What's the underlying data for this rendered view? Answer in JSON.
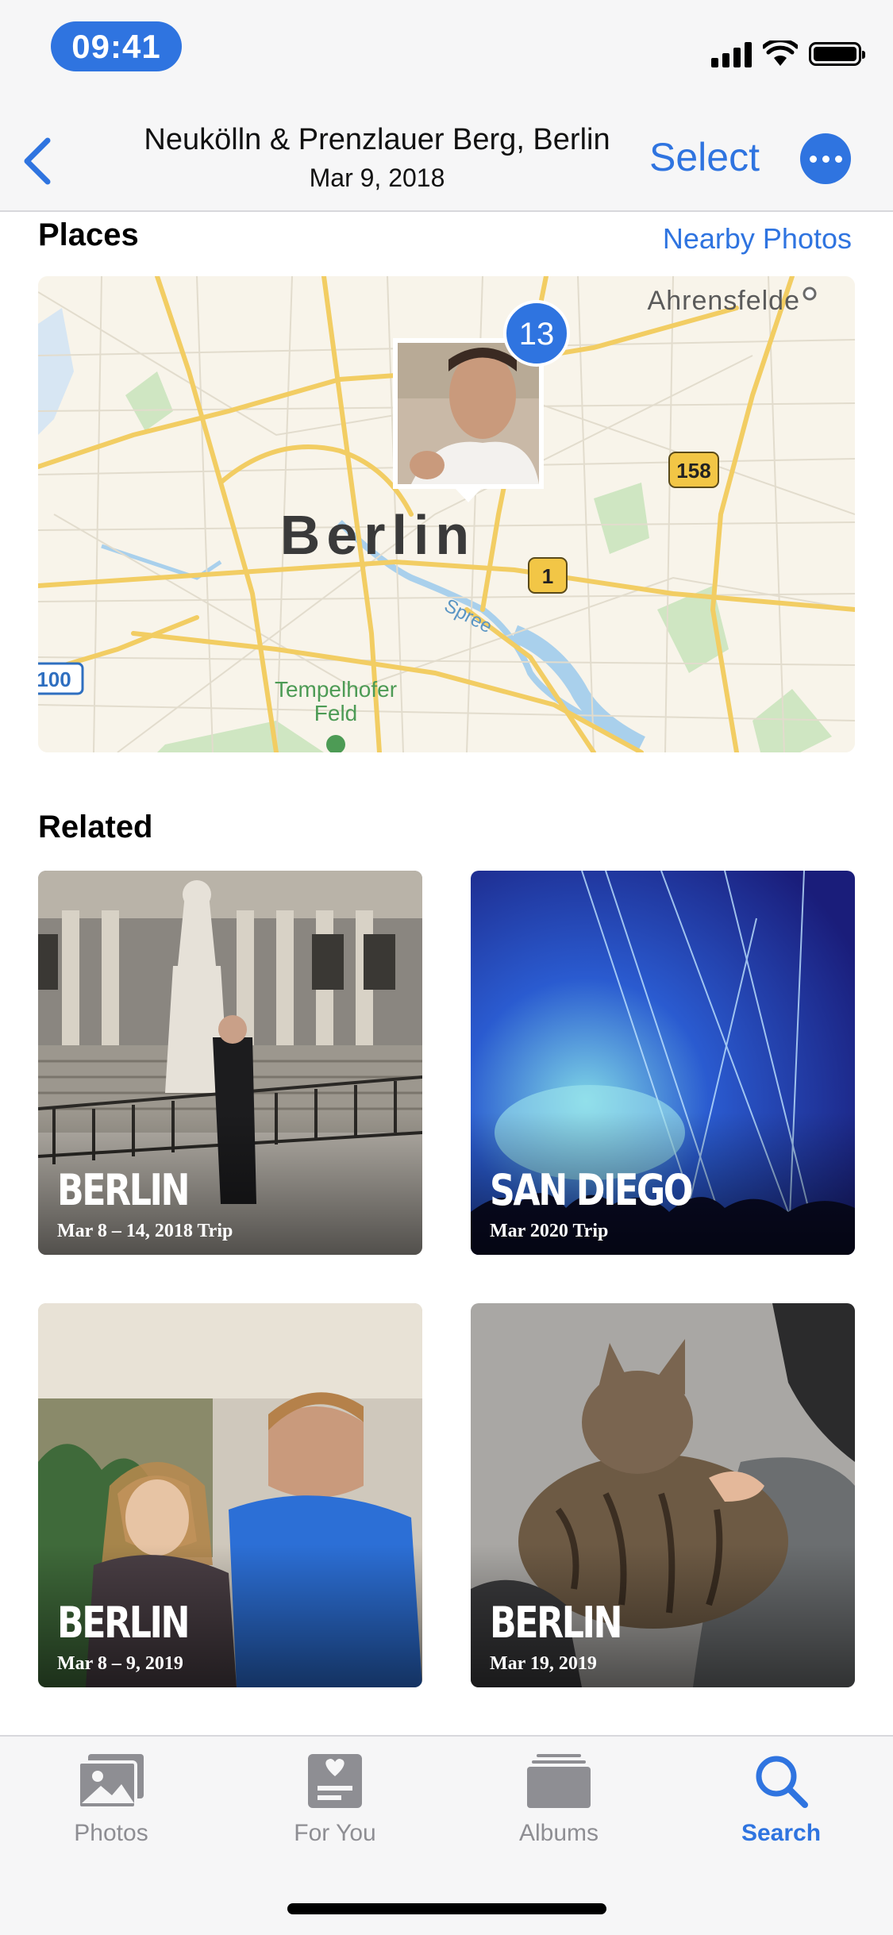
{
  "status_bar": {
    "time": "09:41"
  },
  "nav": {
    "title": "Neukölln & Prenzlauer Berg, Berlin",
    "subtitle": "Mar 9, 2018",
    "select_label": "Select"
  },
  "places": {
    "title": "Places",
    "nearby_label": "Nearby Photos",
    "map": {
      "city_label": "Berlin",
      "district_label_1": "Ahrensfelde",
      "park_label_1": "Tempelhofer",
      "park_label_2": "Feld",
      "river_label": "Spree",
      "road_badge_158": "158",
      "road_badge_1": "1",
      "road_badge_100": "100",
      "photo_count": "13"
    }
  },
  "related": {
    "title": "Related",
    "items": [
      {
        "title": "BERLIN",
        "subtitle": "Mar 8 – 14, 2018 Trip"
      },
      {
        "title": "SAN DIEGO",
        "subtitle": "Mar 2020 Trip"
      },
      {
        "title": "BERLIN",
        "subtitle": "Mar 8 – 9, 2019"
      },
      {
        "title": "BERLIN",
        "subtitle": "Mar 19, 2019"
      }
    ]
  },
  "tab_bar": {
    "tabs": [
      {
        "label": "Photos",
        "icon": "photos-icon"
      },
      {
        "label": "For You",
        "icon": "for-you-icon"
      },
      {
        "label": "Albums",
        "icon": "albums-icon"
      },
      {
        "label": "Search",
        "icon": "search-icon",
        "active": true
      }
    ]
  },
  "colors": {
    "accent": "#2f74e0",
    "tab_inactive": "#8e8e93"
  }
}
